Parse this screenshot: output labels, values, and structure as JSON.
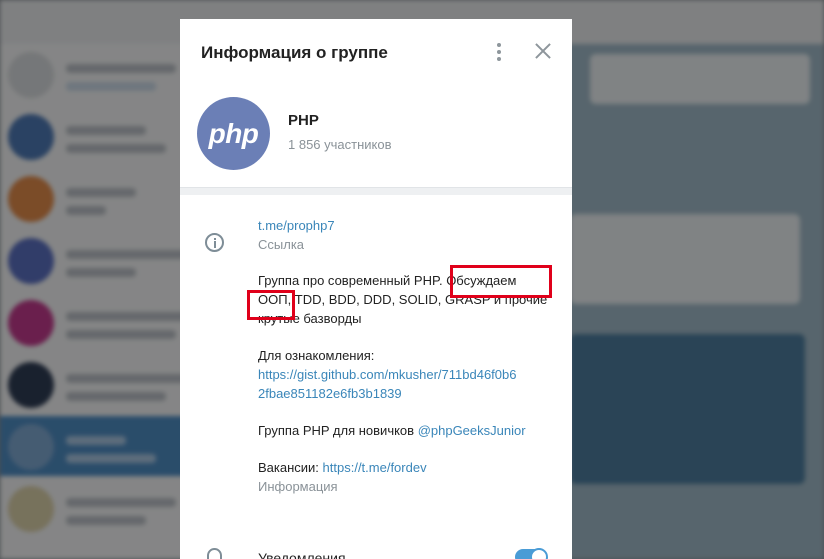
{
  "dialog": {
    "title": "Информация о группе"
  },
  "group": {
    "name": "PHP",
    "members": "1 856 участников",
    "logo_text": "php"
  },
  "info": {
    "link": "t.me/prophp7",
    "link_caption": "Ссылка",
    "description_line1": "Группа про современный PHP. Обсуждаем",
    "description_line2": "ООП, TDD, BDD, DDD, SOLID, GRASP и прочие",
    "description_line3": "крутые базворды",
    "intro_label": "Для ознакомления:",
    "gist_line1": "https://gist.github.com/mkusher/711bd46f0b6",
    "gist_line2": "2fbae851182e6fb3b1839",
    "newbies_text": "Группа PHP для новичков ",
    "newbies_handle": "@phpGeeksJunior",
    "jobs_text": "Вакансии: ",
    "jobs_link": "https://t.me/fordev",
    "info_caption": "Информация"
  },
  "notifications": {
    "label": "Уведомления",
    "enabled": true
  },
  "colors": {
    "logo_bg": "#6b7fb6",
    "link": "#3a86b9",
    "highlight": "#e0001a",
    "toggle": "#4a9cd6"
  }
}
